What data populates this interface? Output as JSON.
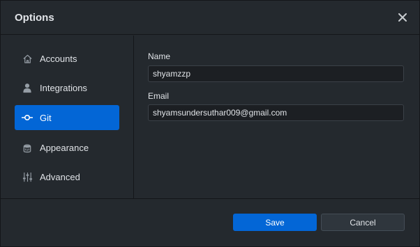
{
  "dialog": {
    "title": "Options",
    "close_icon": "close-icon"
  },
  "sidebar": {
    "items": [
      {
        "label": "Accounts",
        "icon": "home-icon",
        "active": false
      },
      {
        "label": "Integrations",
        "icon": "person-icon",
        "active": false
      },
      {
        "label": "Git",
        "icon": "git-commit-icon",
        "active": true
      },
      {
        "label": "Appearance",
        "icon": "paintcan-icon",
        "active": false
      },
      {
        "label": "Advanced",
        "icon": "settings-sliders-icon",
        "active": false
      }
    ]
  },
  "git": {
    "name_label": "Name",
    "name_value": "shyamzzp",
    "email_label": "Email",
    "email_value": "shyamsundersuthar009@gmail.com"
  },
  "footer": {
    "save_label": "Save",
    "cancel_label": "Cancel"
  },
  "colors": {
    "background": "#24292e",
    "accent": "#0366d6",
    "input_background": "#1c1f23",
    "border": "#141619"
  }
}
